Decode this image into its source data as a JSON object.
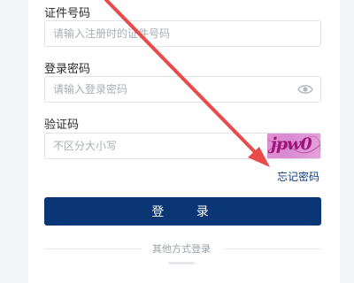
{
  "form": {
    "id_label": "证件号码",
    "id_placeholder": "请输入注册时的证件号码",
    "password_label": "登录密码",
    "password_placeholder": "请输入登录密码",
    "captcha_label": "验证码",
    "captcha_placeholder": "不区分大小写",
    "captcha_image_text": "jpw0",
    "forgot_password": "忘记密码",
    "login_button": "登 录",
    "other_methods": "其他方式登录"
  },
  "colors": {
    "primary": "#0a3676",
    "arrow": "#e94b4b",
    "link": "#0b3d7a"
  },
  "icons": [
    "eye-icon",
    "annotation-arrow"
  ]
}
